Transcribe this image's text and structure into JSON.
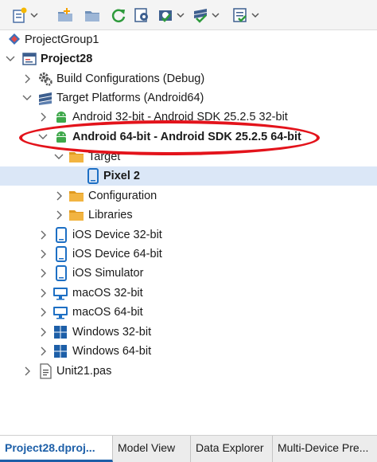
{
  "toolbar": {
    "buttons": [
      {
        "icon": "new-item-icon",
        "has_dropdown": true
      },
      {
        "icon": "add-folder-icon",
        "has_dropdown": false
      },
      {
        "icon": "folder-icon",
        "has_dropdown": false
      },
      {
        "icon": "refresh-icon",
        "has_dropdown": false
      },
      {
        "icon": "project-options-icon",
        "has_dropdown": false
      },
      {
        "icon": "build-gear-icon",
        "has_dropdown": true
      },
      {
        "icon": "build-all-icon",
        "has_dropdown": true
      },
      {
        "icon": "checklist-icon",
        "has_dropdown": true
      }
    ]
  },
  "tree": {
    "project_group": "ProjectGroup1",
    "project": "Project28",
    "build_configurations": "Build Configurations (Debug)",
    "target_platforms": "Target Platforms (Android64)",
    "android32": "Android 32-bit - Android SDK 25.2.5 32-bit",
    "android64": "Android 64-bit - Android SDK 25.2.5 64-bit",
    "target": "Target",
    "pixel2": "Pixel 2",
    "configuration": "Configuration",
    "libraries": "Libraries",
    "ios32": "iOS Device 32-bit",
    "ios64": "iOS Device 64-bit",
    "ios_sim": "iOS Simulator",
    "macos32": "macOS 32-bit",
    "macos64": "macOS 64-bit",
    "win32": "Windows 32-bit",
    "win64": "Windows 64-bit",
    "unit": "Unit21.pas"
  },
  "tabs": {
    "project": "Project28.dproj...",
    "model_view": "Model View",
    "data_explorer": "Data Explorer",
    "multi_device": "Multi-Device Pre..."
  },
  "colors": {
    "highlight": "#e3131b",
    "active_tab": "#1d5fa8",
    "android_green": "#3ea84a",
    "device_blue": "#1d6fc4",
    "folder": "#f2b441"
  }
}
